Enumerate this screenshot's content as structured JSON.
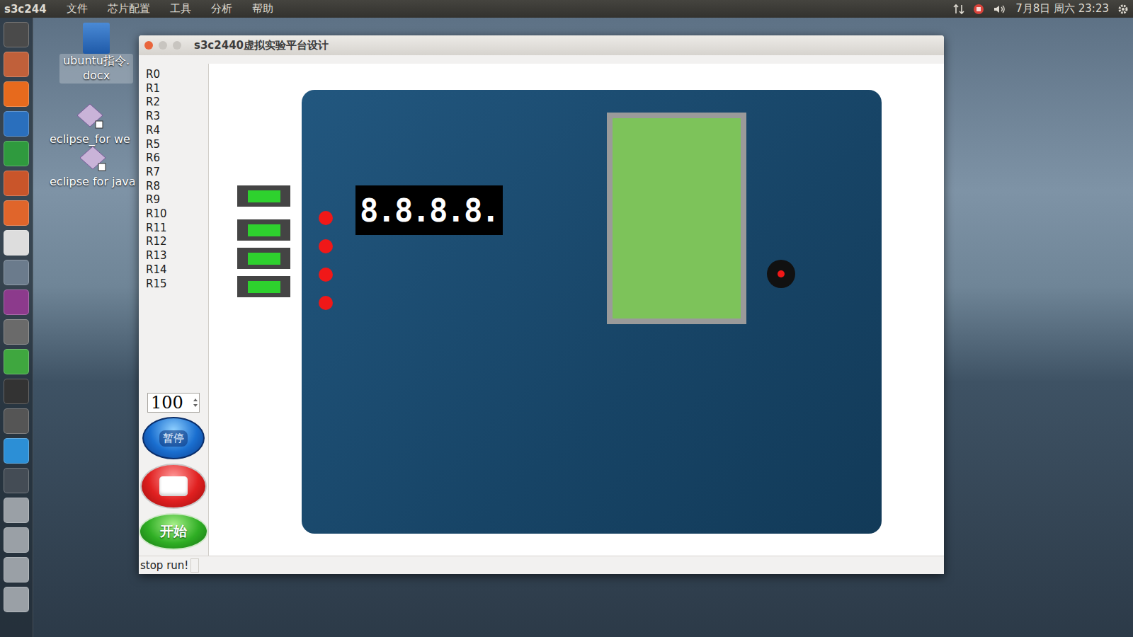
{
  "topbar": {
    "app": "s3c244",
    "menus": [
      "文件",
      "芯片配置",
      "工具",
      "分析",
      "帮助"
    ],
    "datetime": "7月8日 周六 23:23"
  },
  "desktop_icons": [
    {
      "label": "ubuntu指令.docx",
      "selected": true
    },
    {
      "label": "eclipse_for we",
      "selected": false
    },
    {
      "label": "eclipse for java",
      "selected": false
    }
  ],
  "window": {
    "title": "s3c2440虚拟实验平台设计"
  },
  "registers": [
    "R0",
    "R1",
    "R2",
    "R3",
    "R4",
    "R5",
    "R6",
    "R7",
    "R8",
    "R9",
    "R10",
    "R11",
    "R12",
    "R13",
    "R14",
    "R15"
  ],
  "speed": {
    "value": "100"
  },
  "buttons": [
    {
      "label": "暂停",
      "kind": "pause"
    },
    {
      "label": "",
      "kind": "stop"
    },
    {
      "label": "开始",
      "kind": "start"
    }
  ],
  "board": {
    "leds": [
      {
        "on": true
      },
      {
        "on": true
      },
      {
        "on": true
      },
      {
        "on": true
      }
    ],
    "red_dots": [
      {
        "on": true
      },
      {
        "on": true
      },
      {
        "on": true
      },
      {
        "on": true
      }
    ],
    "seven_segment": "8.8.8.8.",
    "lcd": {
      "color": "#7dc35a"
    },
    "buzzer": {
      "on": true
    }
  },
  "status_bar": "stop run!"
}
